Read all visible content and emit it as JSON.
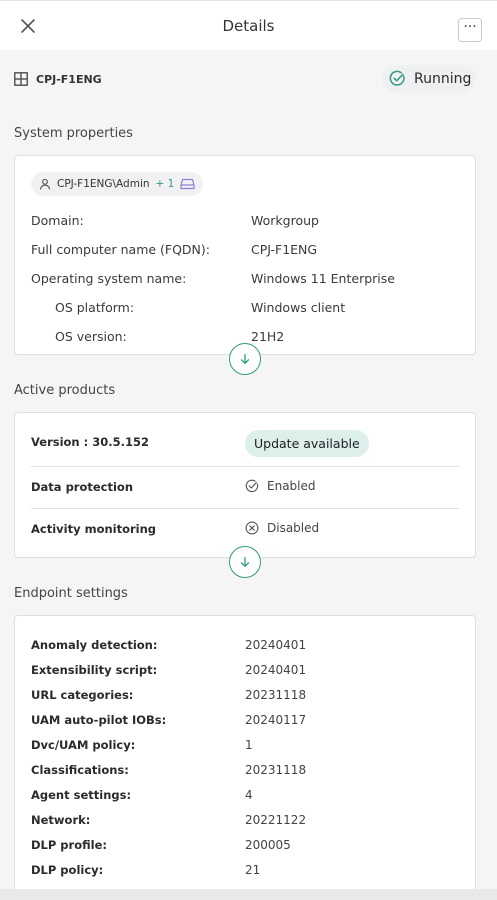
{
  "header": {
    "title": "Details",
    "more_label": "···"
  },
  "machine": {
    "name": "CPJ-F1ENG",
    "status": "Running"
  },
  "system_properties": {
    "title": "System properties",
    "user_chip": {
      "user": "CPJ-F1ENG\\Admin",
      "more": "+ 1"
    },
    "rows": [
      {
        "label": "Domain:",
        "value": "Workgroup"
      },
      {
        "label": "Full computer name (FQDN):",
        "value": "CPJ-F1ENG"
      },
      {
        "label": "Operating system name:",
        "value": "Windows 11 Enterprise"
      },
      {
        "label": "OS platform:",
        "value": "Windows client"
      },
      {
        "label": "OS version:",
        "value": "21H2"
      }
    ]
  },
  "active_products": {
    "title": "Active products",
    "version_label": "Version : 30.5.152",
    "update_badge": "Update available",
    "items": [
      {
        "label": "Data protection",
        "state": "Enabled"
      },
      {
        "label": "Activity monitoring",
        "state": "Disabled"
      }
    ]
  },
  "endpoint_settings": {
    "title": "Endpoint settings",
    "rows": [
      {
        "label": "Anomaly detection:",
        "value": "20240401"
      },
      {
        "label": "Extensibility script:",
        "value": "20240401"
      },
      {
        "label": "URL categories:",
        "value": "20231118"
      },
      {
        "label": "UAM auto-pilot IOBs:",
        "value": "20240117"
      },
      {
        "label": "Dvc/UAM policy:",
        "value": "1"
      },
      {
        "label": "Classifications:",
        "value": "20231118"
      },
      {
        "label": "Agent settings:",
        "value": "4"
      },
      {
        "label": "Network:",
        "value": "20221122"
      },
      {
        "label": "DLP profile:",
        "value": "200005"
      },
      {
        "label": "DLP policy:",
        "value": "21"
      }
    ]
  },
  "colors": {
    "accent": "#2f9a7e",
    "badge_bg": "#dcefea",
    "card_border": "#dfdfe2",
    "page_bg": "#f5f5f6"
  }
}
